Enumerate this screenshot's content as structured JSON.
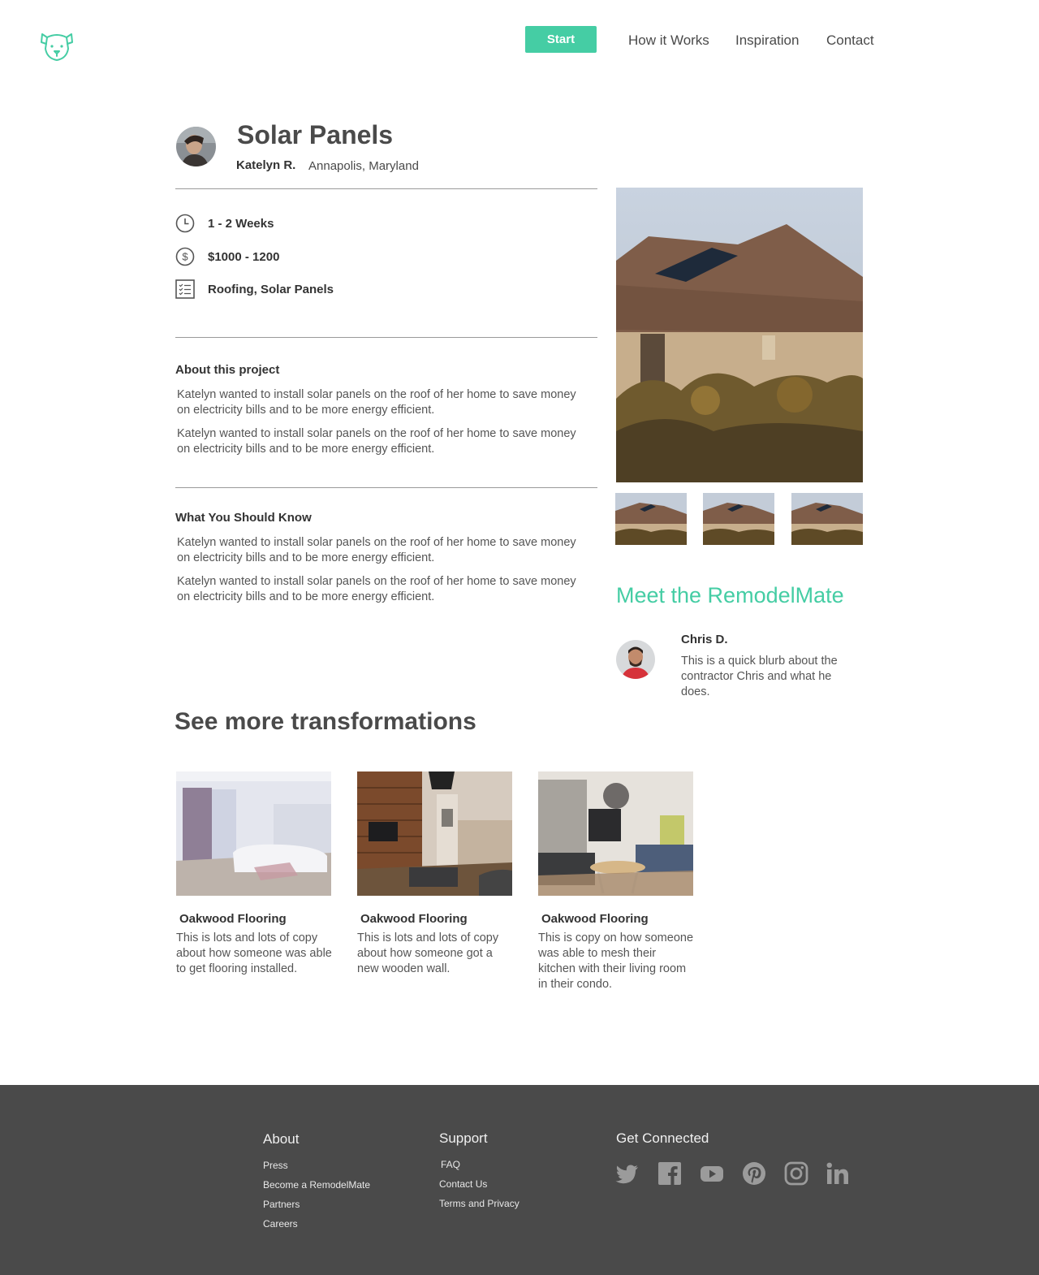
{
  "header": {
    "start_label": "Start",
    "nav": [
      "How it Works",
      "Inspiration",
      "Contact"
    ]
  },
  "project": {
    "title": "Solar Panels",
    "owner_name": "Katelyn R.",
    "owner_location": "Annapolis, Maryland",
    "duration": "1 - 2 Weeks",
    "cost": "$1000 - 1200",
    "categories": "Roofing, Solar Panels",
    "about_heading": "About this project",
    "about_paragraphs": [
      "Katelyn wanted to install solar panels on the roof of her home to save money on electricity bills and to be more energy efficient.",
      "Katelyn wanted to install solar panels on the roof of her home to save money on electricity bills and to be more energy efficient."
    ],
    "know_heading": "What You Should Know",
    "know_paragraphs": [
      "Katelyn wanted to install solar panels on the roof of her home to save money on electricity bills and to be more energy efficient.",
      "Katelyn wanted to install solar panels on the roof of her home to save money on electricity bills and to be more energy efficient."
    ]
  },
  "contractor": {
    "section_title": "Meet the RemodelMate",
    "name": "Chris D.",
    "bio": "This is a quick blurb about the contractor Chris and what he does."
  },
  "transformations": {
    "title": "See more transformations",
    "cards": [
      {
        "title": "Oakwood Flooring",
        "desc": "This is lots and lots of copy about how someone was able to get flooring installed."
      },
      {
        "title": "Oakwood Flooring",
        "desc": "This is lots and lots of copy about how someone got a new wooden wall."
      },
      {
        "title": "Oakwood Flooring",
        "desc": "This is copy on how someone was able to mesh their kitchen with their living room in their condo."
      }
    ]
  },
  "footer": {
    "about": {
      "heading": "About",
      "links": [
        "Press",
        "Become a RemodelMate",
        "Partners",
        "Careers"
      ]
    },
    "support": {
      "heading": "Support",
      "links": [
        "FAQ",
        "Contact Us",
        "Terms and Privacy"
      ]
    },
    "connected": {
      "heading": "Get Connected",
      "icons": [
        "twitter-icon",
        "facebook-icon",
        "youtube-icon",
        "pinterest-icon",
        "instagram-icon",
        "linkedin-icon"
      ]
    }
  },
  "colors": {
    "accent": "#45cda4",
    "text": "#4a4a4a",
    "footer_bg": "#4a4a4a"
  }
}
